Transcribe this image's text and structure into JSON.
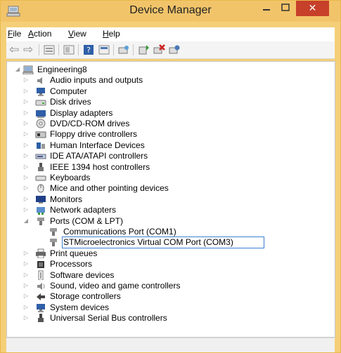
{
  "window": {
    "title": "Device Manager",
    "close_glyph": "✕",
    "minimize_glyph": "–",
    "maximize_glyph": "□"
  },
  "menu": [
    {
      "underline": "F",
      "rest": "ile"
    },
    {
      "underline": "A",
      "rest": "ction"
    },
    {
      "underline": "V",
      "rest": "iew"
    },
    {
      "underline": "H",
      "rest": "elp"
    }
  ],
  "toolbar": {
    "back_glyph": "⇦",
    "forward_glyph": "⇨",
    "buttons": [
      "back-icon",
      "forward-icon",
      "properties-view-icon",
      "refresh-view-icon",
      "help-icon",
      "show-hidden-icon",
      "scan-hardware-icon",
      "update-driver-icon",
      "uninstall-icon",
      "disable-icon"
    ]
  },
  "tree": {
    "root": "Engineering8",
    "categories": [
      "Audio inputs and outputs",
      "Computer",
      "Disk drives",
      "Display adapters",
      "DVD/CD-ROM drives",
      "Floppy drive controllers",
      "Human Interface Devices",
      "IDE ATA/ATAPI controllers",
      "IEEE 1394 host controllers",
      "Keyboards",
      "Mice and other pointing devices",
      "Monitors",
      "Network adapters",
      "Ports (COM & LPT)",
      "Print queues",
      "Processors",
      "Software devices",
      "Sound, video and game controllers",
      "Storage controllers",
      "System devices",
      "Universal Serial Bus controllers"
    ],
    "ports_children": [
      "Communications Port (COM1)",
      "STMicroelectronics Virtual COM Port (COM3)"
    ],
    "expanded_glyph": "◢",
    "collapsed_glyph": "▷"
  },
  "colors": {
    "title_bar": "#f2c46a",
    "close_button": "#c7402a",
    "selection_border": "#3b7fd1"
  }
}
